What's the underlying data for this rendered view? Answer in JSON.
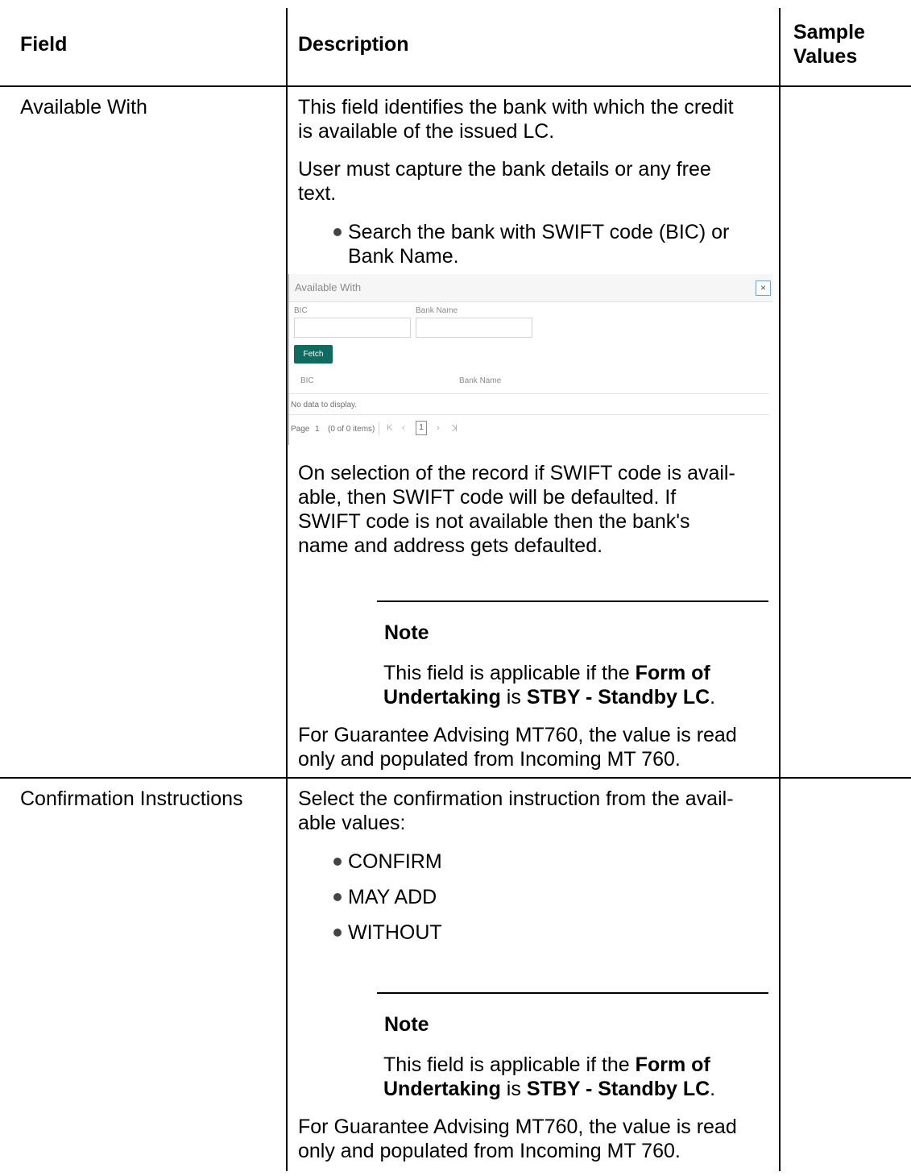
{
  "header": {
    "field": "Field",
    "description": "Description",
    "sample_values_line1": "Sample",
    "sample_values_line2": "Values"
  },
  "rows": [
    {
      "field": "Available With",
      "para1_line1": "This field identifies the bank with which the credit",
      "para1_line2": "is available of the issued LC.",
      "para2_line1": "User must capture the bank details or any free",
      "para2_line2": "text.",
      "bullet1_line1": "Search the bank with SWIFT code (BIC) or",
      "bullet1_line2": "Bank Name.",
      "para3_line1": "On selection of the record if SWIFT code is avail-",
      "para3_line2": "able, then SWIFT code will be defaulted. If",
      "para3_line3": "SWIFT code is not available then the bank's",
      "para3_line4": "name and address gets defaulted.",
      "note_title": "Note",
      "note_pre": "This field is applicable if the ",
      "note_bold1": "Form of",
      "note_bold2": "Undertaking",
      "note_mid": " is ",
      "note_bold3": "STBY - Standby LC",
      "note_end": ".",
      "para4_line1": "For Guarantee Advising MT760, the value is read",
      "para4_line2": "only and populated from Incoming MT 760."
    },
    {
      "field": "Confirmation Instructions",
      "para1_line1": "Select the confirmation instruction from the avail-",
      "para1_line2": "able values:",
      "bullets": [
        "CONFIRM",
        "MAY ADD",
        "WITHOUT"
      ],
      "note_title": "Note",
      "note_pre": "This field is applicable if the ",
      "note_bold1": "Form of",
      "note_bold2": "Undertaking",
      "note_mid": " is ",
      "note_bold3": "STBY - Standby LC",
      "note_end": ".",
      "para2_line1": "For Guarantee Advising MT760, the value is read",
      "para2_line2": "only and populated from Incoming MT 760."
    }
  ],
  "screenshot": {
    "title": "Available With",
    "close": "×",
    "bic_label": "BIC",
    "bank_name_label": "Bank Name",
    "fetch_label": "Fetch",
    "col_bic": "BIC",
    "col_bank_name": "Bank Name",
    "empty": "No data to display.",
    "page_label": "Page",
    "page_number": "1",
    "items_info": "(0 of 0 items)",
    "current_page": "1",
    "first_icon": "first-page-icon",
    "prev_icon": "prev-page-icon",
    "next_icon": "next-page-icon",
    "last_icon": "last-page-icon"
  }
}
